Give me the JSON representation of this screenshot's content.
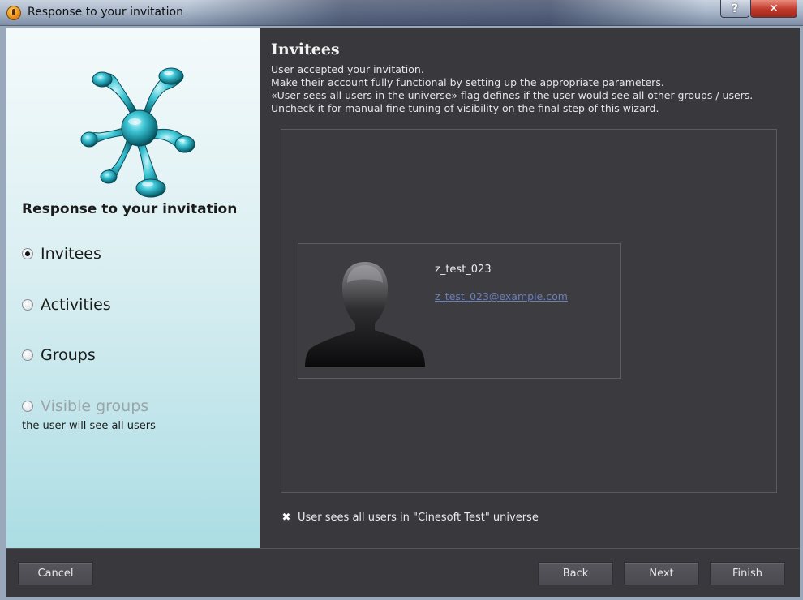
{
  "window": {
    "title": "Response to your invitation",
    "help_label": "?",
    "close_label": "✕"
  },
  "sidebar": {
    "title": "Response to your invitation",
    "steps": [
      {
        "label": "Invitees",
        "checked": true,
        "enabled": true
      },
      {
        "label": "Activities",
        "checked": false,
        "enabled": true
      },
      {
        "label": "Groups",
        "checked": false,
        "enabled": true
      },
      {
        "label": "Visible groups",
        "checked": false,
        "enabled": false
      }
    ],
    "visible_groups_note": "the user will see all users"
  },
  "main": {
    "title": "Invitees",
    "description_lines": [
      "User accepted your invitation.",
      "Make their account fully functional by setting up the appropriate parameters.",
      "«User sees all users in the universe» flag defines if the user would see all other groups / users. Uncheck it for manual fine tuning of visibility on the final step of this wizard."
    ],
    "user": {
      "name": "z_test_023",
      "email": "z_test_023@example.com"
    },
    "sees_all_users": {
      "checked": true,
      "mark": "✖",
      "label": "User sees all users in \"Cinesoft Test\" universe"
    }
  },
  "buttons": {
    "cancel": "Cancel",
    "back": "Back",
    "next": "Next",
    "finish": "Finish"
  },
  "colors": {
    "panel_dark": "#38383d",
    "link": "#6b7fb8",
    "logo": "#1fa0b0"
  }
}
